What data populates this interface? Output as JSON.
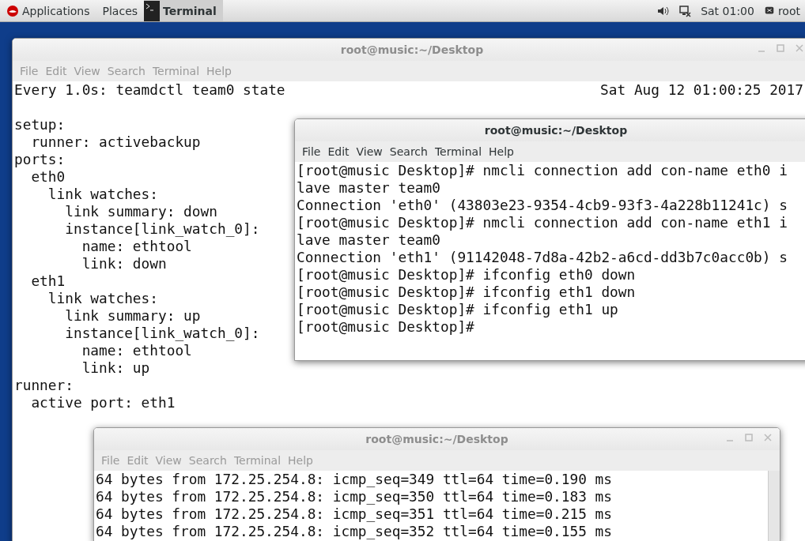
{
  "top_bar": {
    "menus": [
      {
        "label": "Applications",
        "kind": "logo"
      },
      {
        "label": "Places",
        "kind": "plain"
      },
      {
        "label": "Terminal",
        "kind": "app"
      }
    ],
    "clock": "Sat 01:00",
    "user": "root"
  },
  "windows": [
    {
      "title": "root@music:~/Desktop",
      "active": false,
      "menu": [
        "File",
        "Edit",
        "View",
        "Search",
        "Terminal",
        "Help"
      ],
      "header": {
        "command": "Every 1.0s: teamdctl team0 state",
        "time": "Sat Aug 12 01:00:25 2017"
      },
      "lines": [
        "setup:",
        "  runner: activebackup",
        "ports:",
        "  eth0",
        "    link watches:",
        "      link summary: down",
        "      instance[link_watch_0]:",
        "        name: ethtool",
        "        link: down",
        "  eth1",
        "    link watches:",
        "      link summary: up",
        "      instance[link_watch_0]:",
        "        name: ethtool",
        "        link: up",
        "runner:",
        "  active port: eth1"
      ]
    },
    {
      "title": "root@music:~/Desktop",
      "active": true,
      "menu": [
        "File",
        "Edit",
        "View",
        "Search",
        "Terminal",
        "Help"
      ],
      "lines": [
        "[root@music Desktop]# nmcli connection add con-name eth0 i",
        "lave master team0",
        "Connection 'eth0' (43803e23-9354-4cb9-93f3-4a228b11241c) s",
        "[root@music Desktop]# nmcli connection add con-name eth1 i",
        "lave master team0",
        "Connection 'eth1' (91142048-7d8a-42b2-a6cd-dd3b7c0acc0b) s",
        "[root@music Desktop]# ifconfig eth0 down",
        "[root@music Desktop]# ifconfig eth1 down",
        "[root@music Desktop]# ifconfig eth1 up",
        "[root@music Desktop]#"
      ]
    },
    {
      "title": "root@music:~/Desktop",
      "active": false,
      "menu": [
        "File",
        "Edit",
        "View",
        "Search",
        "Terminal",
        "Help"
      ],
      "lines": [
        "64 bytes from 172.25.254.8: icmp_seq=349 ttl=64 time=0.190 ms",
        "64 bytes from 172.25.254.8: icmp_seq=350 ttl=64 time=0.183 ms",
        "64 bytes from 172.25.254.8: icmp_seq=351 ttl=64 time=0.215 ms",
        "64 bytes from 172.25.254.8: icmp_seq=352 ttl=64 time=0.155 ms"
      ]
    }
  ]
}
